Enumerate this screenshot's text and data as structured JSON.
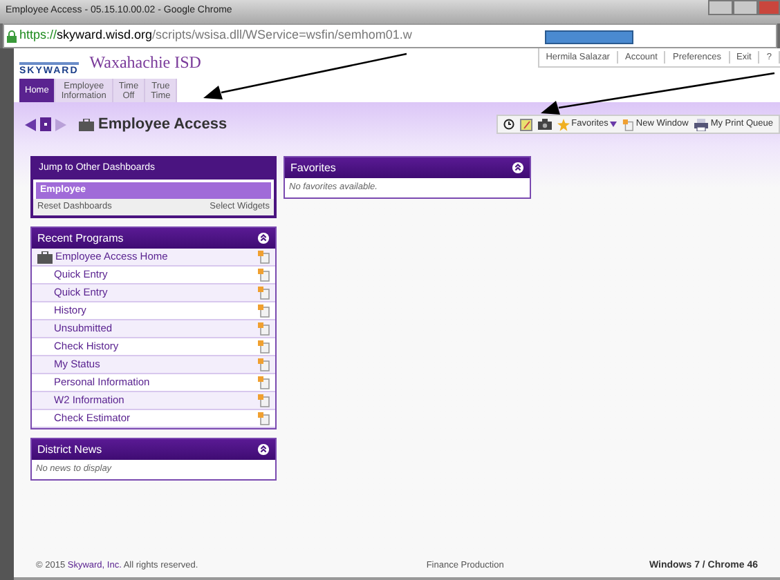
{
  "window": {
    "title": "Employee Access - 05.15.10.00.02 - Google Chrome",
    "url_scheme": "https://",
    "url_host": "skyward.wisd.org",
    "url_path": "/scripts/wsisa.dll/WService=wsfin/semhom01.w"
  },
  "header": {
    "logo": "SKYWARD",
    "district": "Waxahachie ISD",
    "user_links": [
      "Hermila Salazar",
      "Account",
      "Preferences",
      "Exit",
      "?"
    ]
  },
  "tabs": [
    {
      "lines": [
        "Home"
      ],
      "selected": true
    },
    {
      "lines": [
        "Employee",
        "Information"
      ],
      "selected": false
    },
    {
      "lines": [
        "Time",
        "Off"
      ],
      "selected": false
    },
    {
      "lines": [
        "True",
        "Time"
      ],
      "selected": false
    }
  ],
  "page_title": "Employee Access",
  "toolbar": {
    "favorites": "Favorites",
    "new_window": "New Window",
    "print_queue": "My Print Queue"
  },
  "jump_panel": {
    "title": "Jump to Other Dashboards",
    "dashboards": [
      {
        "label": "Employee",
        "selected": true
      }
    ],
    "reset": "Reset Dashboards",
    "widgets": "Select Widgets"
  },
  "recent_programs": {
    "title": "Recent Programs",
    "items": [
      {
        "kind": "home",
        "label": "Employee Access Home"
      },
      {
        "kind": "program",
        "label": "Quick Entry"
      },
      {
        "kind": "program",
        "label": "Quick Entry"
      },
      {
        "kind": "program",
        "label": "History"
      },
      {
        "kind": "program",
        "label": "Unsubmitted"
      },
      {
        "kind": "program",
        "label": "Check History"
      },
      {
        "kind": "program",
        "label": "My Status"
      },
      {
        "kind": "program",
        "label": "Personal Information"
      },
      {
        "kind": "program",
        "label": "W2 Information"
      },
      {
        "kind": "program",
        "label": "Check Estimator"
      }
    ]
  },
  "district_news": {
    "title": "District News",
    "empty": "No news to display"
  },
  "favorites": {
    "title": "Favorites",
    "empty": "No favorites available."
  },
  "footer": {
    "copyright_before": "© 2015",
    "copyright_link": "Skyward, Inc.",
    "copyright_after": "All rights reserved.",
    "environment": "Finance Production",
    "platform": "Windows 7 / Chrome 46"
  }
}
